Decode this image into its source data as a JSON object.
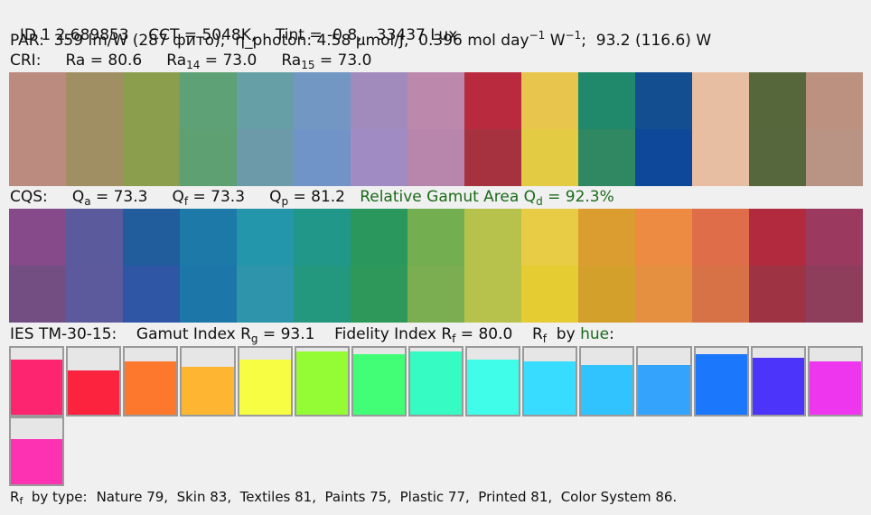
{
  "header": {
    "id": "ID 1 2.689853",
    "cct": "CCT = 5048K,",
    "tint": "Tint = -0.8,",
    "lux": "33437 Lux"
  },
  "par": {
    "prefix": "PAR:  359 lm/W (287 фито);  η_photon: 4.58 μmol/J,  0.396 mol day",
    "sup1": "−1",
    "mid": " W",
    "sup2": "−1",
    "suffix": ";  93.2 (116.6) W"
  },
  "cri": {
    "label": "CRI:",
    "ra": "Ra = 80.6",
    "ra14_pre": "Ra",
    "ra14_sub": "14",
    "ra14_val": " = 73.0",
    "ra15_pre": "Ra",
    "ra15_sub": "15",
    "ra15_val": " = 73.0"
  },
  "cri_swatches": [
    [
      "#bc8b80",
      "#bc8b7f"
    ],
    [
      "#a18f64",
      "#a08f63"
    ],
    [
      "#8a9e4d",
      "#8a9e4e"
    ],
    [
      "#5ea176",
      "#5ea072"
    ],
    [
      "#66a0a6",
      "#6c9aa8"
    ],
    [
      "#7297c3",
      "#7194c8"
    ],
    [
      "#a18bbd",
      "#a08bc3"
    ],
    [
      "#bc88ab",
      "#b886ad"
    ],
    [
      "#ba2a3e",
      "#a63240"
    ],
    [
      "#e8c54d",
      "#e3cb43"
    ],
    [
      "#20896b",
      "#2f8862"
    ],
    [
      "#134f90",
      "#0d489a"
    ],
    [
      "#e8bea3",
      "#e8bea3"
    ],
    [
      "#56673c",
      "#56673d"
    ],
    [
      "#bd9180",
      "#b99383"
    ]
  ],
  "cqs": {
    "label": "CQS:",
    "qa_pre": "Q",
    "qa_sub": "a",
    "qa_val": " = 73.3",
    "qf_pre": "Q",
    "qf_sub": "f",
    "qf_val": " = 73.3",
    "qp_pre": "Q",
    "qp_sub": "p",
    "qp_val": " = 81.2",
    "gamut_pre": "Relative Gamut Area Q",
    "gamut_sub": "d",
    "gamut_val": " = 92.3%"
  },
  "cqs_swatches": [
    [
      "#86498a",
      "#734e82"
    ],
    [
      "#5a5a9c",
      "#5c5a9c"
    ],
    [
      "#215c9c",
      "#2e56a4"
    ],
    [
      "#1c79a8",
      "#1c77a8"
    ],
    [
      "#2496ab",
      "#2e94ab"
    ],
    [
      "#219789",
      "#24977f"
    ],
    [
      "#2a985d",
      "#2d9859"
    ],
    [
      "#73ae51",
      "#7aae51"
    ],
    [
      "#b7c24d",
      "#b7c24d"
    ],
    [
      "#e9cc45",
      "#e6cc33"
    ],
    [
      "#dc9d30",
      "#d3a02c"
    ],
    [
      "#ec8b41",
      "#e59040"
    ],
    [
      "#df6d49",
      "#d67245"
    ],
    [
      "#b12a3e",
      "#9e3343"
    ],
    [
      "#9b395e",
      "#8e3e5b"
    ]
  ],
  "ies": {
    "label": "IES TM-30-15:",
    "rg_pre": "Gamut Index R",
    "rg_sub": "g",
    "rg_val": " = 93.1",
    "rf_pre": "Fidelity Index R",
    "rf_sub": "f",
    "rf_val": " = 80.0",
    "byhue_pre": "R",
    "byhue_sub": "f",
    "byhue_mid": "  by ",
    "byhue_word": "hue",
    "byhue_end": ":"
  },
  "hue_bars": [
    {
      "level": 0.83,
      "color": "#fd2570"
    },
    {
      "level": 0.66,
      "color": "#fc233f"
    },
    {
      "level": 0.79,
      "color": "#fd782c"
    },
    {
      "level": 0.71,
      "color": "#feb632"
    },
    {
      "level": 0.83,
      "color": "#f6fd42"
    },
    {
      "level": 0.95,
      "color": "#94fc35"
    },
    {
      "level": 0.91,
      "color": "#42fd76"
    },
    {
      "level": 0.94,
      "color": "#36fbc2"
    },
    {
      "level": 0.83,
      "color": "#3ffde9"
    },
    {
      "level": 0.79,
      "color": "#38dcfe"
    },
    {
      "level": 0.74,
      "color": "#31c3fd"
    },
    {
      "level": 0.74,
      "color": "#33a3fc"
    },
    {
      "level": 0.91,
      "color": "#1b78fd"
    },
    {
      "level": 0.85,
      "color": "#4c34fb"
    },
    {
      "level": 0.79,
      "color": "#ef36ef"
    },
    {
      "level": 0.68,
      "color": "#fc32b2"
    }
  ],
  "footer": {
    "pre": "R",
    "sub": "f",
    "label": "  by type:",
    "values": "Nature 79,  Skin 83,  Textiles 81,  Paints 75,  Plastic 77,  Printed 81,  Color System 86."
  }
}
